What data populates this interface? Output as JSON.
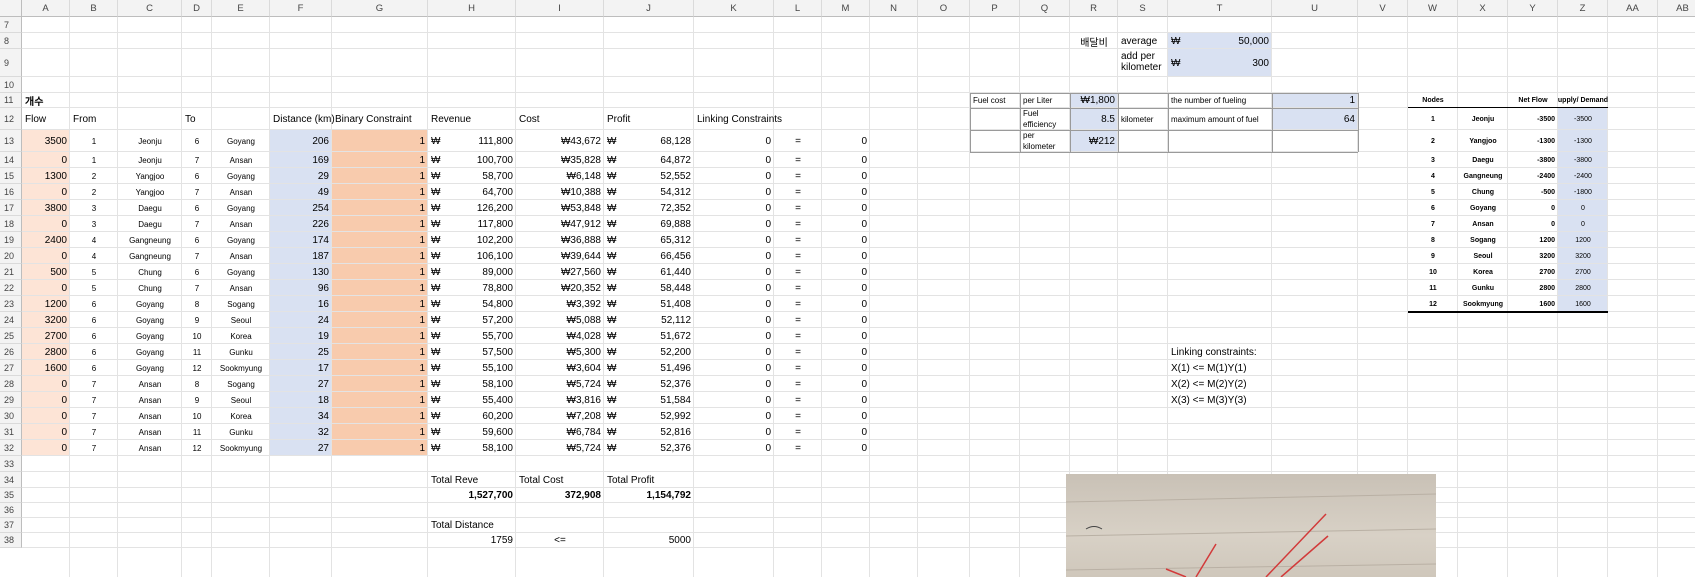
{
  "columns": [
    "A",
    "B",
    "C",
    "D",
    "E",
    "F",
    "G",
    "H",
    "I",
    "J",
    "K",
    "L",
    "M",
    "N",
    "O",
    "P",
    "Q",
    "R",
    "S",
    "T",
    "U",
    "V",
    "W",
    "X",
    "Y",
    "Z",
    "AA",
    "AB"
  ],
  "rows": [
    7,
    8,
    9,
    10,
    11,
    12,
    13,
    14,
    15,
    16,
    17,
    18,
    19,
    20,
    21,
    22,
    23,
    24,
    25,
    26,
    27,
    28,
    29,
    30,
    31,
    32,
    33,
    34,
    35,
    36,
    37,
    38
  ],
  "header_cells": {
    "count_label": "개수",
    "flow": "Flow",
    "from": "From",
    "to": "To",
    "distance": "Distance (km)",
    "binary": "Binary Constraint",
    "revenue": "Revenue",
    "cost": "Cost",
    "profit": "Profit",
    "linking": "Linking Constraints"
  },
  "won": "₩",
  "eq": "=",
  "flow_rows": [
    {
      "flow": "3500",
      "from": "1",
      "from_city": "Jeonju",
      "to": "6",
      "to_city": "Goyang",
      "dist": "206",
      "bin": "1",
      "rev": "111,800",
      "cost": "₩43,672",
      "profit": "68,128",
      "link": "0",
      "rhs": "0"
    },
    {
      "flow": "0",
      "from": "1",
      "from_city": "Jeonju",
      "to": "7",
      "to_city": "Ansan",
      "dist": "169",
      "bin": "1",
      "rev": "100,700",
      "cost": "₩35,828",
      "profit": "64,872",
      "link": "0",
      "rhs": "0"
    },
    {
      "flow": "1300",
      "from": "2",
      "from_city": "Yangjoo",
      "to": "6",
      "to_city": "Goyang",
      "dist": "29",
      "bin": "1",
      "rev": "58,700",
      "cost": "₩6,148",
      "profit": "52,552",
      "link": "0",
      "rhs": "0"
    },
    {
      "flow": "0",
      "from": "2",
      "from_city": "Yangjoo",
      "to": "7",
      "to_city": "Ansan",
      "dist": "49",
      "bin": "1",
      "rev": "64,700",
      "cost": "₩10,388",
      "profit": "54,312",
      "link": "0",
      "rhs": "0"
    },
    {
      "flow": "3800",
      "from": "3",
      "from_city": "Daegu",
      "to": "6",
      "to_city": "Goyang",
      "dist": "254",
      "bin": "1",
      "rev": "126,200",
      "cost": "₩53,848",
      "profit": "72,352",
      "link": "0",
      "rhs": "0"
    },
    {
      "flow": "0",
      "from": "3",
      "from_city": "Daegu",
      "to": "7",
      "to_city": "Ansan",
      "dist": "226",
      "bin": "1",
      "rev": "117,800",
      "cost": "₩47,912",
      "profit": "69,888",
      "link": "0",
      "rhs": "0"
    },
    {
      "flow": "2400",
      "from": "4",
      "from_city": "Gangneung",
      "to": "6",
      "to_city": "Goyang",
      "dist": "174",
      "bin": "1",
      "rev": "102,200",
      "cost": "₩36,888",
      "profit": "65,312",
      "link": "0",
      "rhs": "0"
    },
    {
      "flow": "0",
      "from": "4",
      "from_city": "Gangneung",
      "to": "7",
      "to_city": "Ansan",
      "dist": "187",
      "bin": "1",
      "rev": "106,100",
      "cost": "₩39,644",
      "profit": "66,456",
      "link": "0",
      "rhs": "0"
    },
    {
      "flow": "500",
      "from": "5",
      "from_city": "Chung",
      "to": "6",
      "to_city": "Goyang",
      "dist": "130",
      "bin": "1",
      "rev": "89,000",
      "cost": "₩27,560",
      "profit": "61,440",
      "link": "0",
      "rhs": "0"
    },
    {
      "flow": "0",
      "from": "5",
      "from_city": "Chung",
      "to": "7",
      "to_city": "Ansan",
      "dist": "96",
      "bin": "1",
      "rev": "78,800",
      "cost": "₩20,352",
      "profit": "58,448",
      "link": "0",
      "rhs": "0"
    },
    {
      "flow": "1200",
      "from": "6",
      "from_city": "Goyang",
      "to": "8",
      "to_city": "Sogang",
      "dist": "16",
      "bin": "1",
      "rev": "54,800",
      "cost": "₩3,392",
      "profit": "51,408",
      "link": "0",
      "rhs": "0"
    },
    {
      "flow": "3200",
      "from": "6",
      "from_city": "Goyang",
      "to": "9",
      "to_city": "Seoul",
      "dist": "24",
      "bin": "1",
      "rev": "57,200",
      "cost": "₩5,088",
      "profit": "52,112",
      "link": "0",
      "rhs": "0"
    },
    {
      "flow": "2700",
      "from": "6",
      "from_city": "Goyang",
      "to": "10",
      "to_city": "Korea",
      "dist": "19",
      "bin": "1",
      "rev": "55,700",
      "cost": "₩4,028",
      "profit": "51,672",
      "link": "0",
      "rhs": "0"
    },
    {
      "flow": "2800",
      "from": "6",
      "from_city": "Goyang",
      "to": "11",
      "to_city": "Gunku",
      "dist": "25",
      "bin": "1",
      "rev": "57,500",
      "cost": "₩5,300",
      "profit": "52,200",
      "link": "0",
      "rhs": "0"
    },
    {
      "flow": "1600",
      "from": "6",
      "from_city": "Goyang",
      "to": "12",
      "to_city": "Sookmyung",
      "dist": "17",
      "bin": "1",
      "rev": "55,100",
      "cost": "₩3,604",
      "profit": "51,496",
      "link": "0",
      "rhs": "0"
    },
    {
      "flow": "0",
      "from": "7",
      "from_city": "Ansan",
      "to": "8",
      "to_city": "Sogang",
      "dist": "27",
      "bin": "1",
      "rev": "58,100",
      "cost": "₩5,724",
      "profit": "52,376",
      "link": "0",
      "rhs": "0"
    },
    {
      "flow": "0",
      "from": "7",
      "from_city": "Ansan",
      "to": "9",
      "to_city": "Seoul",
      "dist": "18",
      "bin": "1",
      "rev": "55,400",
      "cost": "₩3,816",
      "profit": "51,584",
      "link": "0",
      "rhs": "0"
    },
    {
      "flow": "0",
      "from": "7",
      "from_city": "Ansan",
      "to": "10",
      "to_city": "Korea",
      "dist": "34",
      "bin": "1",
      "rev": "60,200",
      "cost": "₩7,208",
      "profit": "52,992",
      "link": "0",
      "rhs": "0"
    },
    {
      "flow": "0",
      "from": "7",
      "from_city": "Ansan",
      "to": "11",
      "to_city": "Gunku",
      "dist": "32",
      "bin": "1",
      "rev": "59,600",
      "cost": "₩6,784",
      "profit": "52,816",
      "link": "0",
      "rhs": "0"
    },
    {
      "flow": "0",
      "from": "7",
      "from_city": "Ansan",
      "to": "12",
      "to_city": "Sookmyung",
      "dist": "27",
      "bin": "1",
      "rev": "58,100",
      "cost": "₩5,724",
      "profit": "52,376",
      "link": "0",
      "rhs": "0"
    }
  ],
  "totals": {
    "rev_label": "Total Reve",
    "cost_label": "Total Cost",
    "profit_label": "Total Profit",
    "rev": "1,527,700",
    "cost": "372,908",
    "profit": "1,154,792",
    "dist_label": "Total Distance",
    "dist": "1759",
    "le": "<=",
    "dist_max": "5000"
  },
  "delivery": {
    "label": "배달비",
    "avg_label": "average",
    "avg_value": "50,000",
    "add_label": "add per kilometer",
    "add_value": "300"
  },
  "fuel": {
    "fuel_cost": "Fuel cost",
    "per_liter": "per Liter",
    "per_liter_value": "₩1,800",
    "eff_label": "Fuel efficiency",
    "eff_value": "8.5",
    "eff_unit": "kilometer",
    "per_km_label": "per kilometer",
    "per_km_value": "₩212",
    "num_fuel_label": "the number of fueling",
    "num_fuel_value": "1",
    "max_fuel_label": "maximum amount of fuel",
    "max_fuel_value": "64"
  },
  "nodes_table": {
    "hdr_nodes": "Nodes",
    "hdr_net": "Net Flow",
    "hdr_sd": "upply/ Demand",
    "rows": [
      {
        "n": "1",
        "name": "Jeonju",
        "net": "-3500",
        "sd": "-3500"
      },
      {
        "n": "2",
        "name": "Yangjoo",
        "net": "-1300",
        "sd": "-1300"
      },
      {
        "n": "3",
        "name": "Daegu",
        "net": "-3800",
        "sd": "-3800"
      },
      {
        "n": "4",
        "name": "Gangneung",
        "net": "-2400",
        "sd": "-2400"
      },
      {
        "n": "5",
        "name": "Chung",
        "net": "-500",
        "sd": "-1800"
      },
      {
        "n": "6",
        "name": "Goyang",
        "net": "0",
        "sd": "0"
      },
      {
        "n": "7",
        "name": "Ansan",
        "net": "0",
        "sd": "0"
      },
      {
        "n": "8",
        "name": "Sogang",
        "net": "1200",
        "sd": "1200"
      },
      {
        "n": "9",
        "name": "Seoul",
        "net": "3200",
        "sd": "3200"
      },
      {
        "n": "10",
        "name": "Korea",
        "net": "2700",
        "sd": "2700"
      },
      {
        "n": "11",
        "name": "Gunku",
        "net": "2800",
        "sd": "2800"
      },
      {
        "n": "12",
        "name": "Sookmyung",
        "net": "1600",
        "sd": "1600"
      }
    ]
  },
  "linking_notes": [
    "Linking constraints:",
    "X(1) <= M(1)Y(1)",
    "X(2) <= M(2)Y(2)",
    "X(3) <= M(3)Y(3)"
  ],
  "colors": {
    "flow_fill": "#fde4d6",
    "dist_fill": "#d9e1f2",
    "bin_fill": "#f8cbad",
    "header_bg": "#f3f3f3",
    "photo_ink": "#d23a3a"
  }
}
